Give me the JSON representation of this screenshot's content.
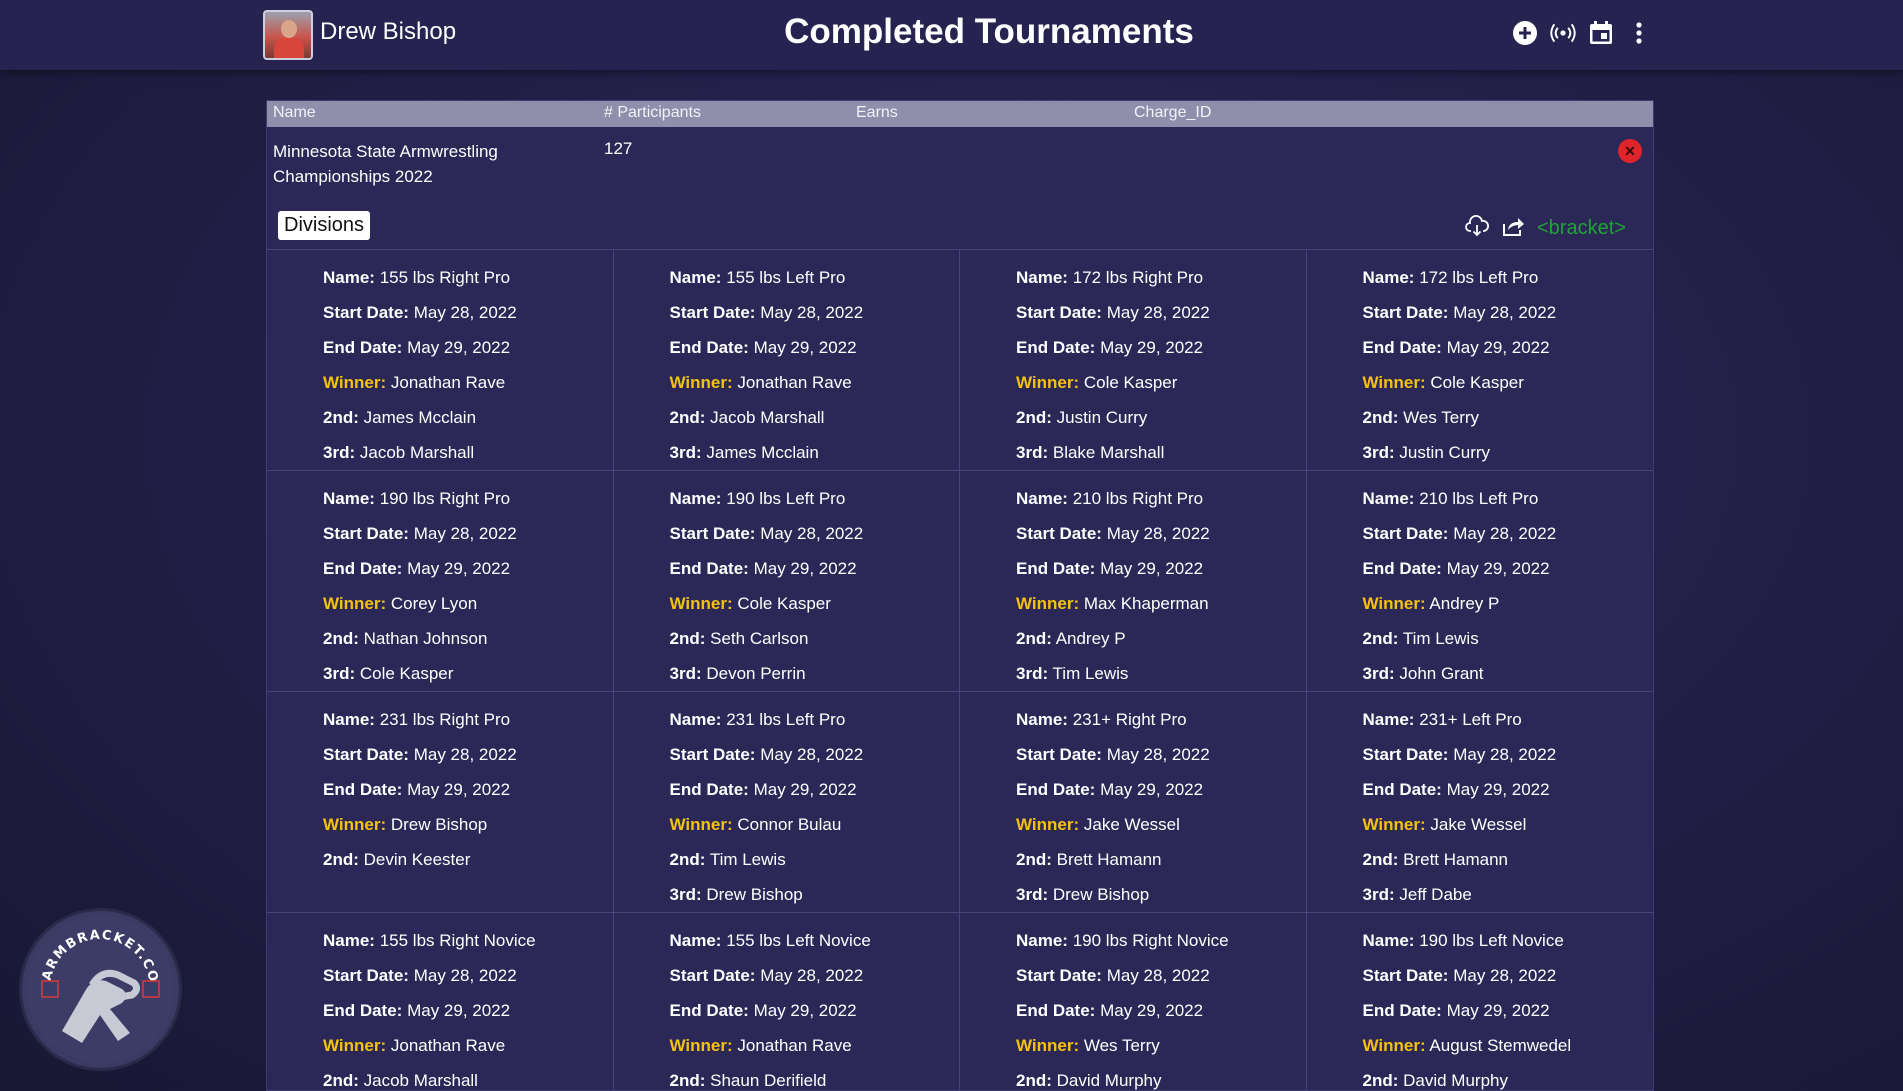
{
  "header": {
    "username": "Drew Bishop",
    "title": "Completed Tournaments",
    "icons": [
      "add-circle-icon",
      "broadcast-icon",
      "calendar-icon",
      "more-vert-icon"
    ]
  },
  "table": {
    "columns": [
      "Name",
      "# Participants",
      "Earns",
      "Charge_ID"
    ],
    "row": {
      "name": "Minnesota State Armwrestling Championships 2022",
      "participants": "127",
      "earns": "",
      "charge_id": ""
    }
  },
  "divisions": {
    "label": "Divisions",
    "bracket_link": "<bracket>",
    "labels": {
      "name": "Name:",
      "start": "Start Date:",
      "end": "End Date:",
      "winner": "Winner:",
      "second": "2nd:",
      "third": "3rd:"
    },
    "items": [
      {
        "name": "155 lbs Right Pro",
        "start": "May 28, 2022",
        "end": "May 29, 2022",
        "winner": "Jonathan Rave",
        "second": "James Mcclain",
        "third": "Jacob Marshall"
      },
      {
        "name": "155 lbs Left Pro",
        "start": "May 28, 2022",
        "end": "May 29, 2022",
        "winner": "Jonathan Rave",
        "second": "Jacob Marshall",
        "third": "James Mcclain"
      },
      {
        "name": "172 lbs Right Pro",
        "start": "May 28, 2022",
        "end": "May 29, 2022",
        "winner": "Cole Kasper",
        "second": "Justin Curry",
        "third": "Blake Marshall"
      },
      {
        "name": "172 lbs Left Pro",
        "start": "May 28, 2022",
        "end": "May 29, 2022",
        "winner": "Cole Kasper",
        "second": "Wes Terry",
        "third": "Justin Curry"
      },
      {
        "name": "190 lbs Right Pro",
        "start": "May 28, 2022",
        "end": "May 29, 2022",
        "winner": "Corey Lyon",
        "second": "Nathan Johnson",
        "third": "Cole Kasper"
      },
      {
        "name": "190 lbs Left Pro",
        "start": "May 28, 2022",
        "end": "May 29, 2022",
        "winner": "Cole Kasper",
        "second": "Seth Carlson",
        "third": "Devon Perrin"
      },
      {
        "name": "210 lbs Right Pro",
        "start": "May 28, 2022",
        "end": "May 29, 2022",
        "winner": "Max Khaperman",
        "second": "Andrey P",
        "third": "Tim Lewis"
      },
      {
        "name": "210 lbs Left Pro",
        "start": "May 28, 2022",
        "end": "May 29, 2022",
        "winner": "Andrey P",
        "second": "Tim Lewis",
        "third": "John Grant"
      },
      {
        "name": "231 lbs Right Pro",
        "start": "May 28, 2022",
        "end": "May 29, 2022",
        "winner": "Drew Bishop",
        "second": "Devin Keester",
        "third": null
      },
      {
        "name": "231 lbs Left Pro",
        "start": "May 28, 2022",
        "end": "May 29, 2022",
        "winner": "Connor Bulau",
        "second": "Tim Lewis",
        "third": "Drew Bishop"
      },
      {
        "name": "231+ Right Pro",
        "start": "May 28, 2022",
        "end": "May 29, 2022",
        "winner": "Jake Wessel",
        "second": "Brett Hamann",
        "third": "Drew Bishop"
      },
      {
        "name": "231+ Left Pro",
        "start": "May 28, 2022",
        "end": "May 29, 2022",
        "winner": "Jake Wessel",
        "second": "Brett Hamann",
        "third": "Jeff Dabe"
      },
      {
        "name": "155 lbs Right Novice",
        "start": "May 28, 2022",
        "end": "May 29, 2022",
        "winner": "Jonathan Rave",
        "second": "Jacob Marshall",
        "third": null
      },
      {
        "name": "155 lbs Left Novice",
        "start": "May 28, 2022",
        "end": "May 29, 2022",
        "winner": "Jonathan Rave",
        "second": "Shaun Derifield",
        "third": null
      },
      {
        "name": "190 lbs Right Novice",
        "start": "May 28, 2022",
        "end": "May 29, 2022",
        "winner": "Wes Terry",
        "second": "David Murphy",
        "third": null
      },
      {
        "name": "190 lbs Left Novice",
        "start": "May 28, 2022",
        "end": "May 29, 2022",
        "winner": "August Stemwedel",
        "second": "David Murphy",
        "third": null
      }
    ]
  },
  "logo": {
    "text": "ARMBRACKET.COM"
  },
  "colors": {
    "winner_label": "#f4c20d",
    "bracket_link": "#1fa336",
    "delete": "#e0242b"
  }
}
